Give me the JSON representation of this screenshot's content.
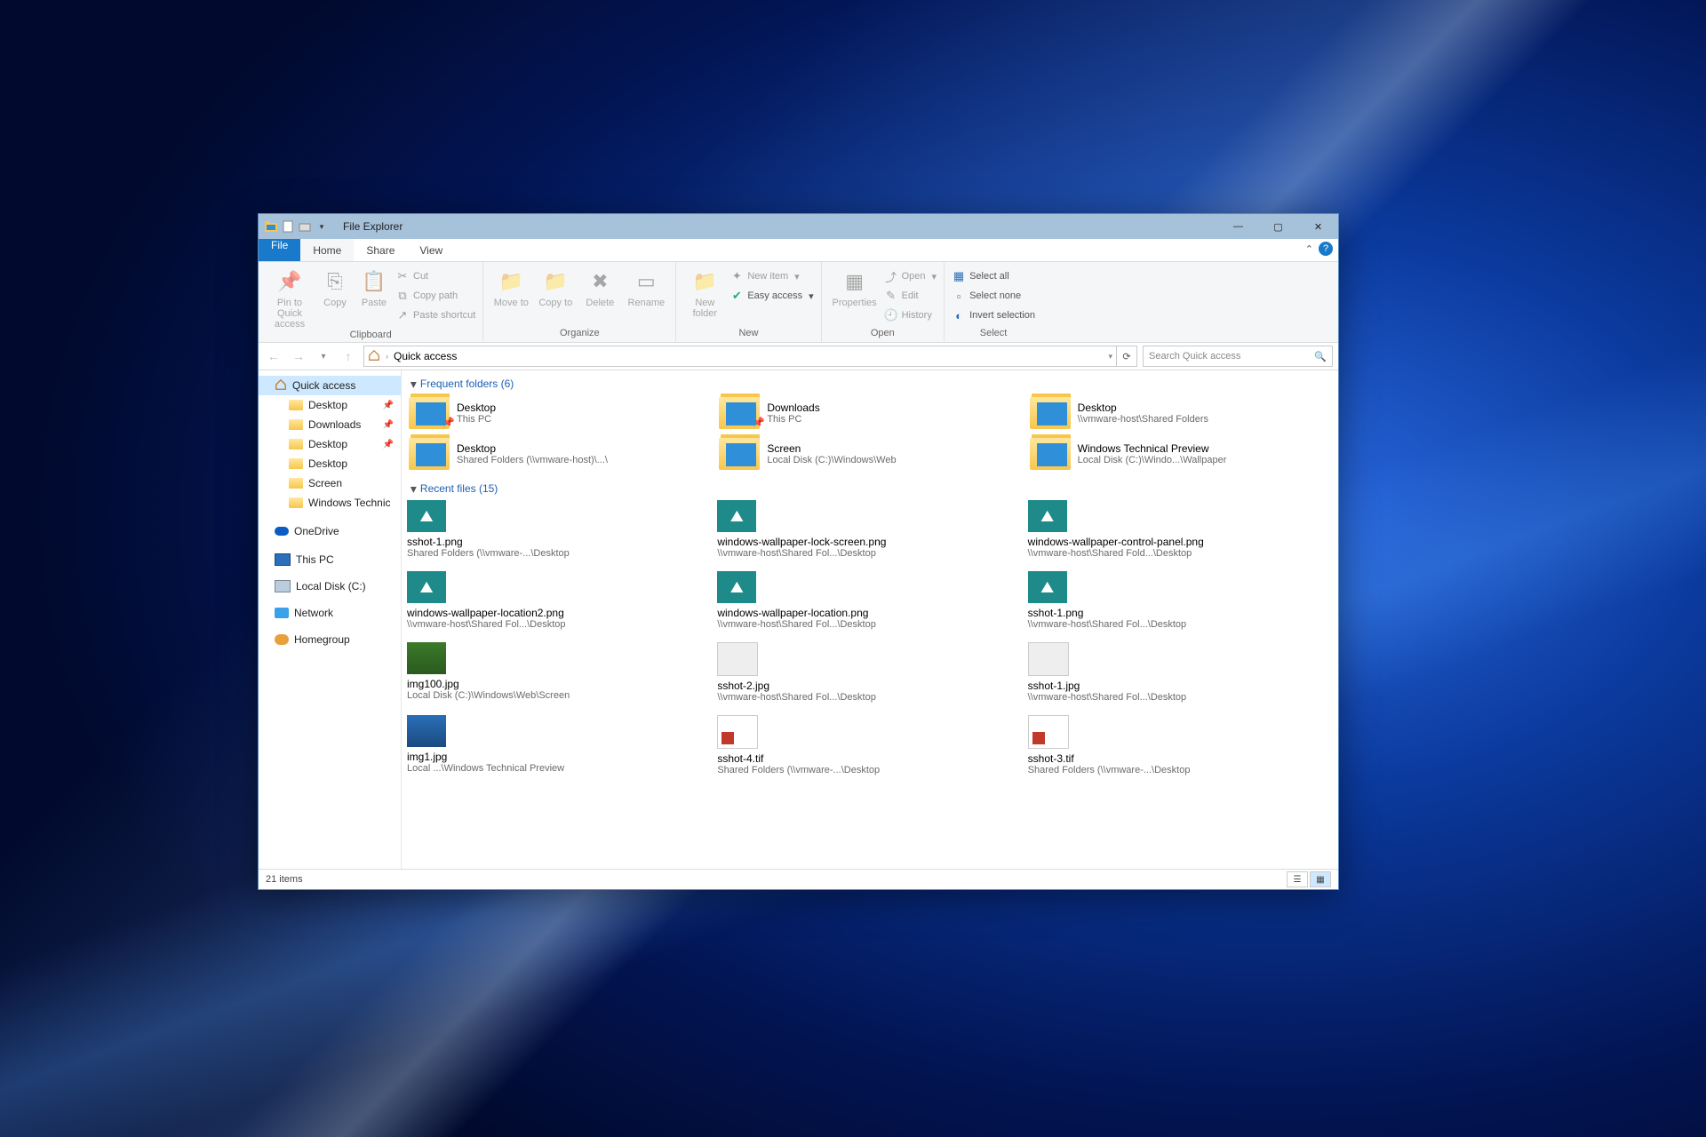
{
  "window": {
    "title": "File Explorer"
  },
  "tabs": {
    "file": "File",
    "home": "Home",
    "share": "Share",
    "view": "View"
  },
  "ribbon": {
    "clipboard": {
      "label": "Clipboard",
      "pin": "Pin to Quick access",
      "copy": "Copy",
      "paste": "Paste",
      "cut": "Cut",
      "copypath": "Copy path",
      "pasteshort": "Paste shortcut"
    },
    "organize": {
      "label": "Organize",
      "moveto": "Move to",
      "copyto": "Copy to",
      "delete": "Delete",
      "rename": "Rename"
    },
    "new": {
      "label": "New",
      "newfolder": "New folder",
      "newitem": "New item",
      "easyaccess": "Easy access"
    },
    "open": {
      "label": "Open",
      "properties": "Properties",
      "open": "Open",
      "edit": "Edit",
      "history": "History"
    },
    "select": {
      "label": "Select",
      "all": "Select all",
      "none": "Select none",
      "invert": "Invert selection"
    }
  },
  "address": {
    "location": "Quick access"
  },
  "search": {
    "placeholder": "Search Quick access"
  },
  "sidebar": {
    "quick": "Quick access",
    "items": [
      {
        "label": "Desktop",
        "pinned": true
      },
      {
        "label": "Downloads",
        "pinned": true
      },
      {
        "label": "Desktop",
        "pinned": true
      },
      {
        "label": "Desktop",
        "pinned": false
      },
      {
        "label": "Screen",
        "pinned": false
      },
      {
        "label": "Windows Technic",
        "pinned": false
      }
    ],
    "onedrive": "OneDrive",
    "thispc": "This PC",
    "localdisk": "Local Disk (C:)",
    "network": "Network",
    "homegroup": "Homegroup"
  },
  "groups": {
    "frequent": "Frequent folders (6)",
    "recent": "Recent files (15)"
  },
  "folders": [
    {
      "name": "Desktop",
      "path": "This PC",
      "pinned": true
    },
    {
      "name": "Downloads",
      "path": "This PC",
      "pinned": true
    },
    {
      "name": "Desktop",
      "path": "\\\\vmware-host\\Shared Folders"
    },
    {
      "name": "Desktop",
      "path": "Shared Folders (\\\\vmware-host)\\...\\"
    },
    {
      "name": "Screen",
      "path": "Local Disk (C:)\\Windows\\Web"
    },
    {
      "name": "Windows Technical Preview",
      "path": "Local Disk (C:)\\Windo...\\Wallpaper"
    }
  ],
  "files": [
    {
      "name": "sshot-1.png",
      "path": "Shared Folders (\\\\vmware-...\\Desktop",
      "kind": "png"
    },
    {
      "name": "windows-wallpaper-lock-screen.png",
      "path": "\\\\vmware-host\\Shared Fol...\\Desktop",
      "kind": "png"
    },
    {
      "name": "windows-wallpaper-control-panel.png",
      "path": "\\\\vmware-host\\Shared Fold...\\Desktop",
      "kind": "png"
    },
    {
      "name": "windows-wallpaper-location2.png",
      "path": "\\\\vmware-host\\Shared Fol...\\Desktop",
      "kind": "png"
    },
    {
      "name": "windows-wallpaper-location.png",
      "path": "\\\\vmware-host\\Shared Fol...\\Desktop",
      "kind": "png"
    },
    {
      "name": "sshot-1.png",
      "path": "\\\\vmware-host\\Shared Fol...\\Desktop",
      "kind": "png"
    },
    {
      "name": "img100.jpg",
      "path": "Local Disk (C:)\\Windows\\Web\\Screen",
      "kind": "green"
    },
    {
      "name": "sshot-2.jpg",
      "path": "\\\\vmware-host\\Shared Fol...\\Desktop",
      "kind": "jpg"
    },
    {
      "name": "sshot-1.jpg",
      "path": "\\\\vmware-host\\Shared Fol...\\Desktop",
      "kind": "jpg"
    },
    {
      "name": "img1.jpg",
      "path": "Local ...\\Windows Technical Preview",
      "kind": "blue"
    },
    {
      "name": "sshot-4.tif",
      "path": "Shared Folders (\\\\vmware-...\\Desktop",
      "kind": "tif"
    },
    {
      "name": "sshot-3.tif",
      "path": "Shared Folders (\\\\vmware-...\\Desktop",
      "kind": "tif"
    }
  ],
  "status": {
    "items": "21 items"
  }
}
